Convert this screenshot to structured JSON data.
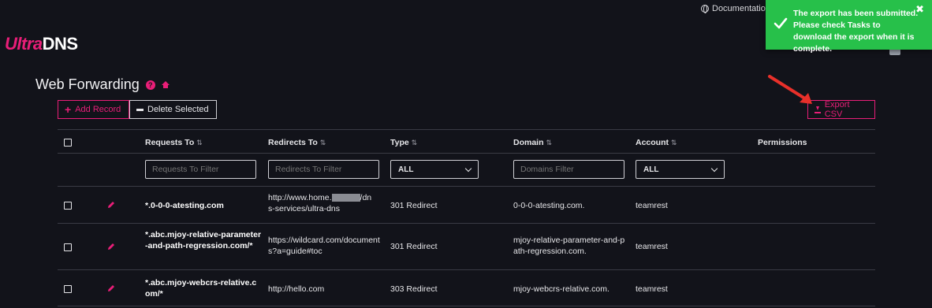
{
  "header": {
    "logo_ultra": "Ultra",
    "logo_dns": "DNS",
    "documentation_label": "Documentation"
  },
  "toast": {
    "message": "The export has been submitted. Please check Tasks to download the export when it is complete.",
    "close": "✖",
    "color": "#27c04a"
  },
  "page": {
    "title": "Web Forwarding",
    "help_glyph": "?"
  },
  "toolbar": {
    "add_label": "Add Record",
    "delete_label": "Delete Selected",
    "export_label": "Export CSV"
  },
  "table": {
    "columns": {
      "requests_to": "Requests To",
      "redirects_to": "Redirects To",
      "type": "Type",
      "domain": "Domain",
      "account": "Account",
      "permissions": "Permissions"
    },
    "sort_glyph": "⇅",
    "filters": {
      "requests_placeholder": "Requests To Filter",
      "redirects_placeholder": "Redirects To Filter",
      "type_value": "ALL",
      "domains_placeholder": "Domains Filter",
      "account_value": "ALL"
    },
    "rows": [
      {
        "requests_to": "*.0-0-0-atesting.com",
        "redirects_to_a": "http://www.home.",
        "redirects_to_b": "/dn",
        "redirects_to_c": "s-services/ultra-dns",
        "type": "301 Redirect",
        "domain": "0-0-0-atesting.com.",
        "account": "teamrest"
      },
      {
        "requests_to": "*.abc.mjoy-relative-parameter-and-path-regression.com/*",
        "redirects_to": "https://wildcard.com/documents?a=guide#toc",
        "type": "301 Redirect",
        "domain": "mjoy-relative-parameter-and-path-regression.com.",
        "account": "teamrest"
      },
      {
        "requests_to": "*.abc.mjoy-webcrs-relative.com/*",
        "redirects_to": "http://hello.com",
        "type": "303 Redirect",
        "domain": "mjoy-webcrs-relative.com.",
        "account": "teamrest"
      }
    ]
  },
  "colors": {
    "accent": "#e91e78",
    "background": "#12131a",
    "toast": "#27c04a"
  }
}
